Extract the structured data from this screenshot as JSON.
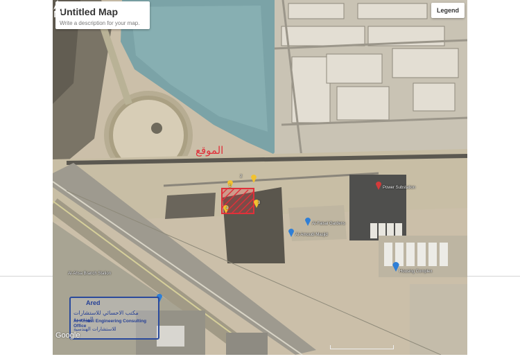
{
  "map": {
    "title": "Untitled Map",
    "description": "Write a description for your map.",
    "legend_label": "Legend",
    "site_label": "الموقع",
    "corner_numbers": [
      "1",
      "2",
      "3",
      "4"
    ],
    "google_label": "Google",
    "colors": {
      "site_outline": "#e0303a",
      "corner_pin": "#f2c230",
      "place_pin": "#2f7fd6"
    }
  },
  "places": [
    {
      "name": "Al-Faisal Gardens",
      "icon": "blue-pin-icon"
    },
    {
      "name": "Al-Amoudi Masjid",
      "icon": "blue-pin-icon"
    },
    {
      "name": "Housing Complex",
      "icon": "blue-pin-icon"
    },
    {
      "name": "Al-Ahsa Branch Station",
      "icon": "blue-pin-icon"
    },
    {
      "name": "Power Substation",
      "icon": "red-pin-icon"
    }
  ],
  "stamp": {
    "line1": "Ared",
    "line2": "مكتب الاحسائي للاستشارات الهندسية",
    "line3": "Al-Ahsaei Engineering Consulting Office",
    "line4": "للاستشارات الهندسية"
  }
}
